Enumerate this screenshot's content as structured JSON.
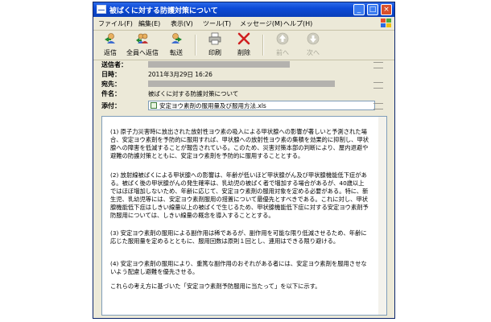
{
  "window": {
    "title": "被ばくに対する防護対策について",
    "controls": {
      "minimize": "_",
      "maximize": "□",
      "close": "×"
    }
  },
  "menubar": {
    "items": [
      "ファイル(F)",
      "編集(E)",
      "表示(V)",
      "ツール(T)",
      "メッセージ(M)",
      "ヘルプ(H)"
    ]
  },
  "toolbar": {
    "reply": {
      "label": "返信",
      "icon": "reply-icon"
    },
    "reply_all": {
      "label": "全員へ返信",
      "icon": "reply-all-icon"
    },
    "forward": {
      "label": "転送",
      "icon": "forward-icon"
    },
    "print": {
      "label": "印刷",
      "icon": "printer-icon"
    },
    "delete": {
      "label": "削除",
      "icon": "delete-x-icon"
    },
    "previous": {
      "label": "前へ",
      "icon": "up-arrow-icon"
    },
    "next": {
      "label": "次へ",
      "icon": "down-arrow-icon"
    }
  },
  "header": {
    "from_label": "送信者：",
    "date_label": "日時：",
    "date_value": "2011年3月29日 16:26",
    "to_label": "宛先：",
    "subject_label": "件名：",
    "subject_value": "被ばくに対する防護対策について",
    "attach_label": "添付：",
    "attachment_name": "安定ヨウ素剤の服用量及び服用方法.xls"
  },
  "body": {
    "paragraphs": [
      "(1) 原子力災害時に放出された放射性ヨウ素の吸入による甲状腺への影響が著しいと予測された場合、安定ヨウ素剤を予防的に服用すれば、甲状腺への放射性ヨウ素の集積を効果的に抑制し、甲状腺への障害を低減することが報告されている。このため、災害対策本部の判断により、屋内退避や避難の防護対策とともに、安定ヨウ素剤を予防的に服用することとする。",
      "(2) 放射線被ばくによる甲状腺への影響は、年齢が低いほど甲状腺がん及び甲状腺機能低下症がある。被ばく後の甲状腺がんの発生確率は、乳幼児の被ばく者で増加する場合があるが、40歳以上ではほぼ増加しないため、年齢に応じて、安定ヨウ素剤の服用対象を定める必要がある。特に、新生児、乳幼児等には、安定ヨウ素剤服用の措置について最優先とすべきである。これに対し、甲状腺機能低下症はしきい線量以上の被ばくで生じるため、甲状腺機能低下症に対する安定ヨウ素剤予防服用については、しきい線量の概念を導入することとする。",
      "(3) 安定ヨウ素剤の服用による副作用は稀であるが、副作用を可能な限り低減させるため、年齢に応じた服用量を定めるとともに、服用回数は原則１回とし、連用はできる限り避ける。",
      "(4) 安定ヨウ素剤の服用により、重篤な副作用のおそれがある者には、安定ヨウ素剤を服用させないよう配慮し避難を優先させる。",
      "これらの考え方に基づいた「安定ヨウ素剤予防服用に当たって」を以下に示す。"
    ]
  },
  "colors": {
    "titlebar": "#0c4ad8",
    "window_face": "#ece9d8",
    "delete_red": "#d02020",
    "redacted_gray": "#b4b2ae"
  }
}
